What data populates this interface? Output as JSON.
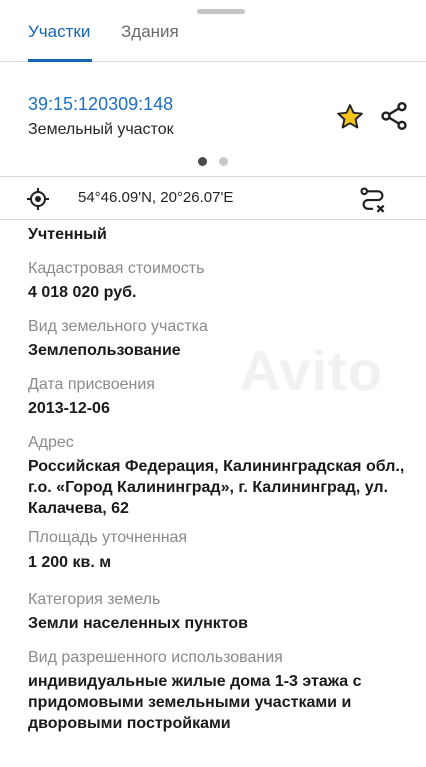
{
  "tabs": [
    {
      "label": "Участки",
      "active": true
    },
    {
      "label": "Здания",
      "active": false
    }
  ],
  "parcel": {
    "cadastral_number": "39:15:120309:148",
    "type": "Земельный участок"
  },
  "pager": {
    "count": 2,
    "active_index": 0
  },
  "coordinates": {
    "text": "54°46.09'N, 20°26.07'E"
  },
  "details": {
    "status": "Учтенный",
    "fields": [
      {
        "label": "Кадастровая стоимость",
        "value": "4 018 020 руб."
      },
      {
        "label": "Вид земельного участка",
        "value": "Землепользование"
      },
      {
        "label": "Дата присвоения",
        "value": "2013-12-06"
      },
      {
        "label": "Адрес",
        "value": "Российская Федерация, Калининградская обл., г.о. «Город Калининград», г. Калининград, ул. Калачева, 62"
      },
      {
        "label": "Площадь уточненная",
        "value": "1 200 кв. м"
      },
      {
        "label": "Категория земель",
        "value": "Земли населенных пунктов"
      },
      {
        "label": "Вид разрешенного использования",
        "value": "индивидуальные жилые дома 1-3 этажа с придомовыми земельными участками и дворовыми постройками"
      }
    ]
  },
  "watermark": "Avito",
  "colors": {
    "accent": "#1565b5",
    "link": "#1e6fc0",
    "star": "#f2c318",
    "label": "#8a8a8a"
  },
  "icons": [
    "star-icon",
    "share-icon",
    "locate-icon",
    "route-clear-icon"
  ]
}
